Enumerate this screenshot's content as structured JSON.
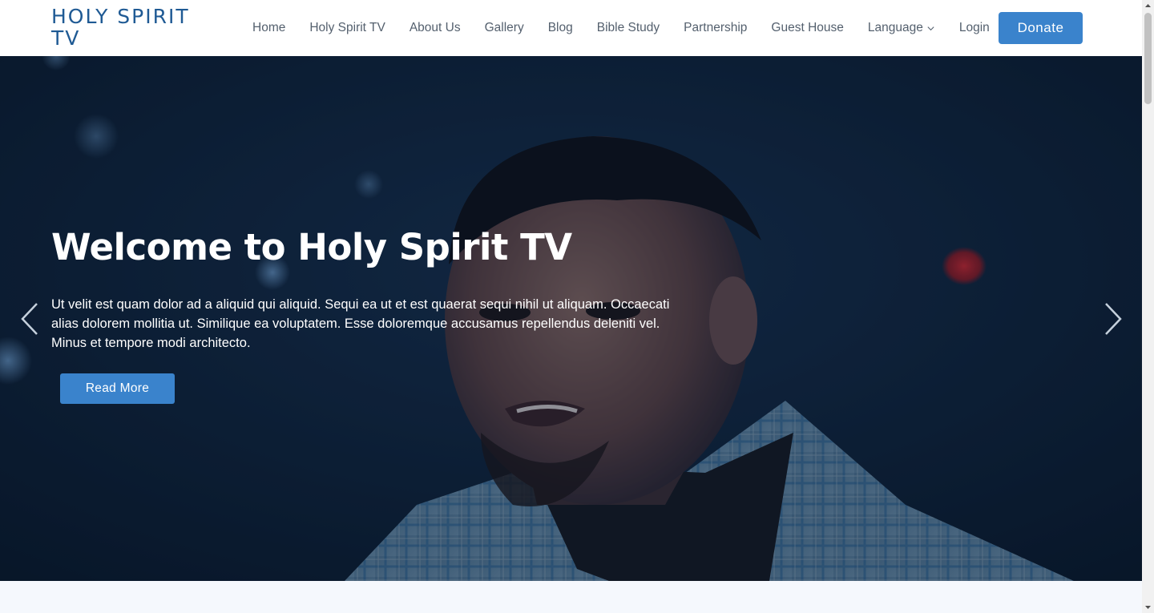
{
  "header": {
    "logo": "HOLY SPIRIT TV",
    "nav": [
      {
        "label": "Home"
      },
      {
        "label": "Holy Spirit TV"
      },
      {
        "label": "About Us"
      },
      {
        "label": "Gallery"
      },
      {
        "label": "Blog"
      },
      {
        "label": "Bible Study"
      },
      {
        "label": "Partnership"
      },
      {
        "label": "Guest House"
      },
      {
        "label": "Language",
        "icon": "chevron-down-icon"
      },
      {
        "label": "Login"
      }
    ],
    "donate_label": "Donate"
  },
  "hero": {
    "title": "Welcome to Holy Spirit TV",
    "text": "Ut velit est quam dolor ad a aliquid qui aliquid. Sequi ea ut et est quaerat sequi nihil ut aliquam. Occaecati alias dolorem mollitia ut. Similique ea voluptatem. Esse doloremque accusamus repellendus deleniti vel. Minus et tempore modi architecto.",
    "button_label": "Read More",
    "prev_icon": "chevron-left-icon",
    "next_icon": "chevron-right-icon"
  },
  "colors": {
    "brand": "#1f5a94",
    "accent": "#3a83cc",
    "nav_text": "#54606e",
    "hero_bg": "#0c1d33"
  }
}
